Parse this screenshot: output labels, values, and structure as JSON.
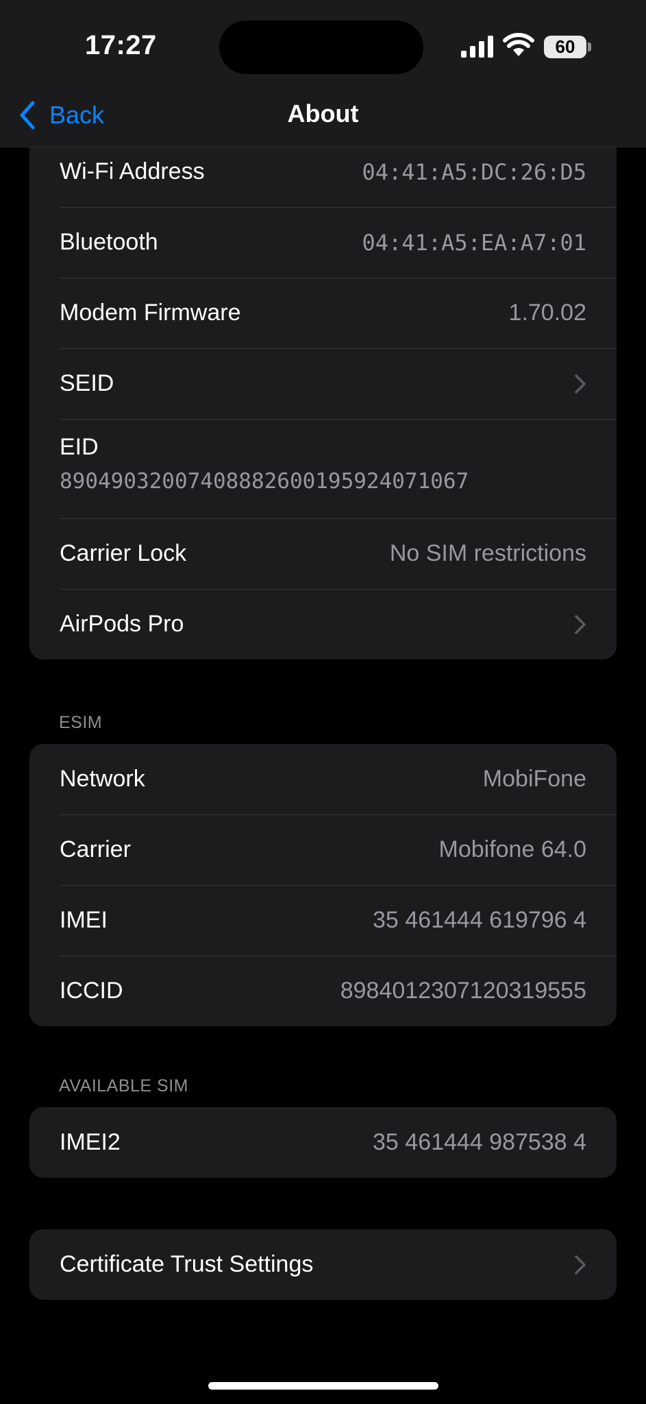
{
  "status_bar": {
    "time": "17:27",
    "battery": "60"
  },
  "nav": {
    "back_label": "Back",
    "title": "About"
  },
  "device_group": {
    "wifi_address": {
      "label": "Wi-Fi Address",
      "value": "04:41:A5:DC:26:D5"
    },
    "bluetooth": {
      "label": "Bluetooth",
      "value": "04:41:A5:EA:A7:01"
    },
    "modem_firmware": {
      "label": "Modem Firmware",
      "value": "1.70.02"
    },
    "seid": {
      "label": "SEID"
    },
    "eid": {
      "label": "EID",
      "value": "89049032007408882600195924071067"
    },
    "carrier_lock": {
      "label": "Carrier Lock",
      "value": "No SIM restrictions"
    },
    "airpods": {
      "label": "AirPods Pro"
    }
  },
  "esim": {
    "header": "ESIM",
    "network": {
      "label": "Network",
      "value": "MobiFone"
    },
    "carrier": {
      "label": "Carrier",
      "value": "Mobifone 64.0"
    },
    "imei": {
      "label": "IMEI",
      "value": "35 461444 619796 4"
    },
    "iccid": {
      "label": "ICCID",
      "value": "8984012307120319555"
    }
  },
  "available_sim": {
    "header": "AVAILABLE SIM",
    "imei2": {
      "label": "IMEI2",
      "value": "35 461444 987538 4"
    }
  },
  "certificate": {
    "label": "Certificate Trust Settings"
  },
  "colors": {
    "accent": "#0a84ff",
    "background": "#000000",
    "cell": "#1c1c1e",
    "secondary_text": "#98989f"
  }
}
